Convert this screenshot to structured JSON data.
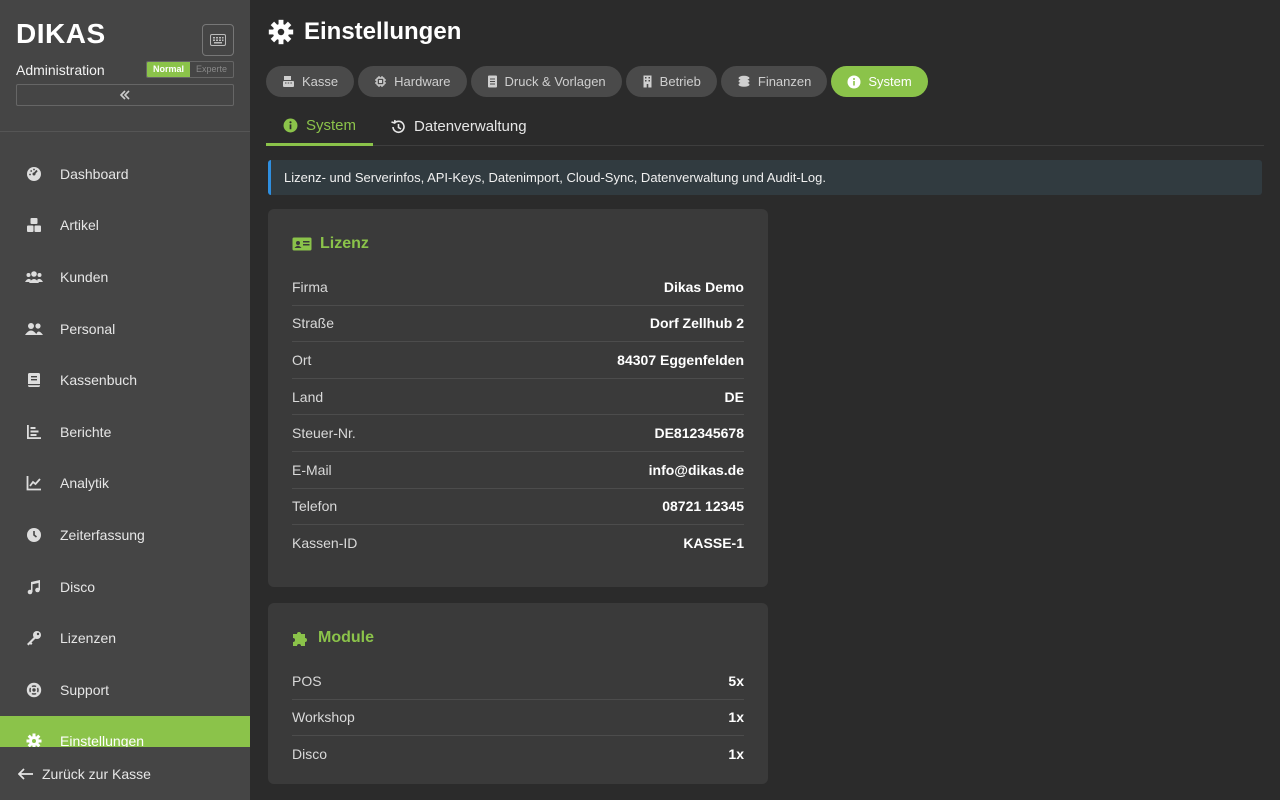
{
  "sidebar": {
    "logo": "DIKAS",
    "subtitle": "Administration",
    "mode_normal": "Normal",
    "mode_expert": "Experte",
    "items": [
      {
        "label": "Dashboard",
        "icon": "dashboard-icon"
      },
      {
        "label": "Artikel",
        "icon": "boxes-icon"
      },
      {
        "label": "Kunden",
        "icon": "users-icon"
      },
      {
        "label": "Personal",
        "icon": "user-group-icon"
      },
      {
        "label": "Kassenbuch",
        "icon": "book-icon"
      },
      {
        "label": "Berichte",
        "icon": "bar-chart-icon"
      },
      {
        "label": "Analytik",
        "icon": "line-chart-icon"
      },
      {
        "label": "Zeiterfassung",
        "icon": "clock-icon"
      },
      {
        "label": "Disco",
        "icon": "music-icon"
      },
      {
        "label": "Lizenzen",
        "icon": "key-icon"
      },
      {
        "label": "Support",
        "icon": "lifebuoy-icon"
      },
      {
        "label": "Einstellungen",
        "icon": "gear-icon",
        "active": true
      }
    ],
    "back_label": "Zurück zur Kasse"
  },
  "header": {
    "title": "Einstellungen"
  },
  "top_tabs": [
    {
      "label": "Kasse",
      "icon": "register-icon"
    },
    {
      "label": "Hardware",
      "icon": "chip-icon"
    },
    {
      "label": "Druck & Vorlagen",
      "icon": "document-icon"
    },
    {
      "label": "Betrieb",
      "icon": "building-icon"
    },
    {
      "label": "Finanzen",
      "icon": "coins-icon"
    },
    {
      "label": "System",
      "icon": "info-icon",
      "active": true
    }
  ],
  "sub_tabs": [
    {
      "label": "System",
      "icon": "info-icon",
      "active": true
    },
    {
      "label": "Datenverwaltung",
      "icon": "history-icon"
    }
  ],
  "info_text": "Lizenz- und Serverinfos, API-Keys, Datenimport, Cloud-Sync, Datenverwaltung und Audit-Log.",
  "license": {
    "title": "Lizenz",
    "rows": [
      {
        "key": "Firma",
        "value": "Dikas Demo"
      },
      {
        "key": "Straße",
        "value": "Dorf Zellhub 2"
      },
      {
        "key": "Ort",
        "value": "84307 Eggenfelden"
      },
      {
        "key": "Land",
        "value": "DE"
      },
      {
        "key": "Steuer-Nr.",
        "value": "DE812345678"
      },
      {
        "key": "E-Mail",
        "value": "info@dikas.de"
      },
      {
        "key": "Telefon",
        "value": "08721 12345"
      },
      {
        "key": "Kassen-ID",
        "value": "KASSE-1"
      }
    ]
  },
  "modules": {
    "title": "Module",
    "rows": [
      {
        "key": "POS",
        "value": "5x"
      },
      {
        "key": "Workshop",
        "value": "1x"
      },
      {
        "key": "Disco",
        "value": "1x"
      }
    ]
  },
  "colors": {
    "accent": "#8bc34a",
    "sidebar_bg": "#454545",
    "main_bg": "#2b2b2b",
    "card_bg": "#3a3a3a",
    "info_border": "#2f8fe0"
  }
}
